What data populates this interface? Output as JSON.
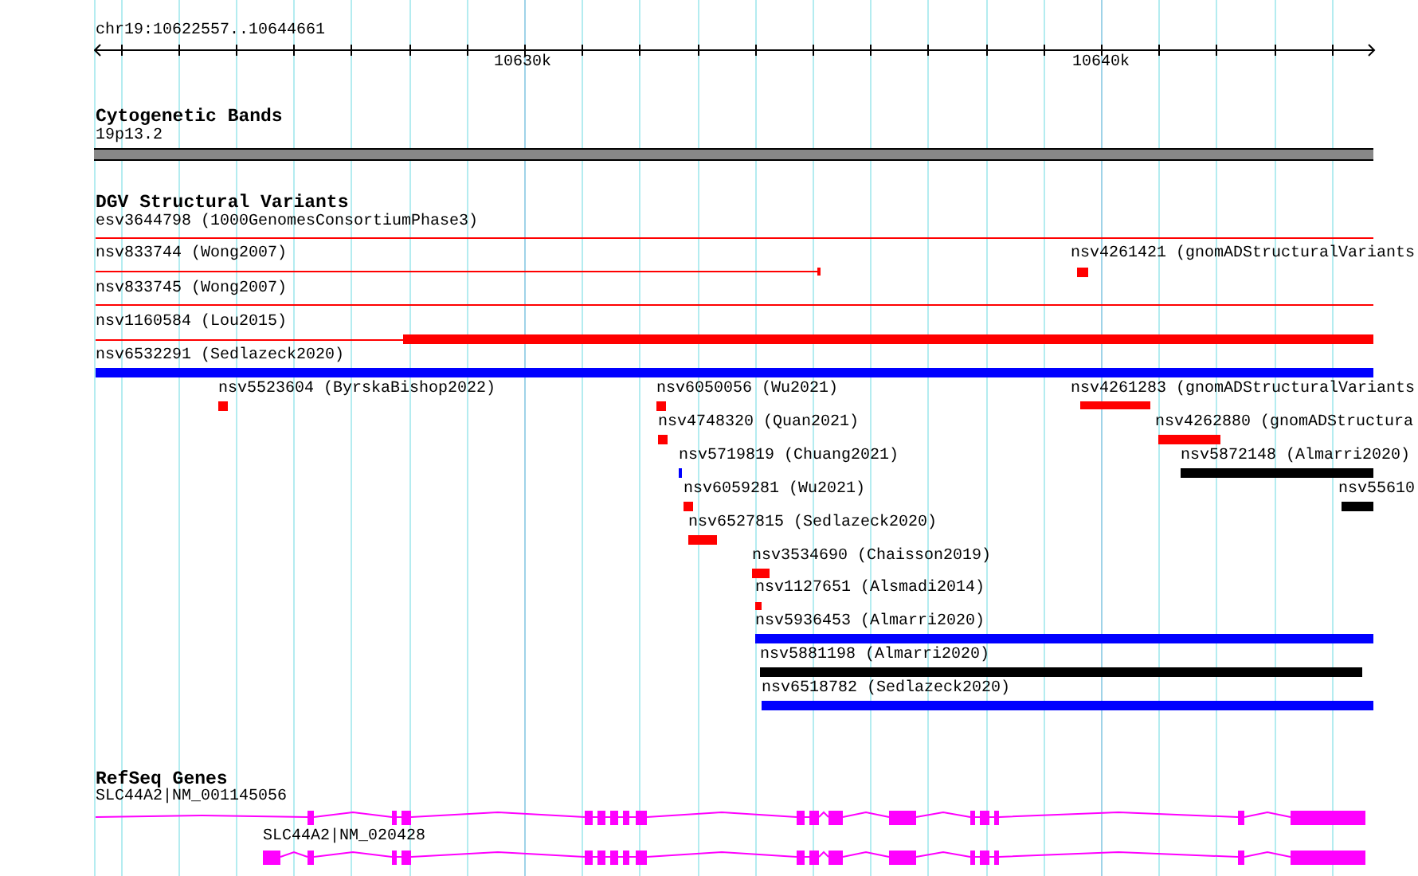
{
  "ruler": {
    "location": "chr19:10622557..10644661",
    "tick_labels": [
      "10630k",
      "10640k"
    ]
  },
  "cytogenetic": {
    "title": "Cytogenetic Bands",
    "band": "19p13.2"
  },
  "dgv": {
    "title": "DGV Structural Variants",
    "variants": [
      {
        "label": "esv3644798 (1000GenomesConsortiumPhase3)",
        "color": "#ff0000"
      },
      {
        "label": "nsv833744 (Wong2007)",
        "color": "#ff0000"
      },
      {
        "label": "nsv4261421 (gnomADStructuralVariants",
        "color": "#ff0000"
      },
      {
        "label": "nsv833745 (Wong2007)",
        "color": "#ff0000"
      },
      {
        "label": "nsv1160584 (Lou2015)",
        "color": "#ff0000"
      },
      {
        "label": "nsv6532291 (Sedlazeck2020)",
        "color": "#0000ff"
      },
      {
        "label": "nsv5523604 (ByrskaBishop2022)",
        "color": "#ff0000"
      },
      {
        "label": "nsv6050056 (Wu2021)",
        "color": "#ff0000"
      },
      {
        "label": "nsv4261283 (gnomADStructuralVariants",
        "color": "#ff0000"
      },
      {
        "label": "nsv4748320 (Quan2021)",
        "color": "#ff0000"
      },
      {
        "label": "nsv4262880 (gnomADStructura",
        "color": "#ff0000"
      },
      {
        "label": "nsv5719819 (Chuang2021)",
        "color": "#0000ff"
      },
      {
        "label": "nsv5872148 (Almarri2020)",
        "color": "#000000"
      },
      {
        "label": "nsv6059281 (Wu2021)",
        "color": "#ff0000"
      },
      {
        "label": "nsv55610",
        "color": "#000000"
      },
      {
        "label": "nsv6527815 (Sedlazeck2020)",
        "color": "#ff0000"
      },
      {
        "label": "nsv3534690 (Chaisson2019)",
        "color": "#ff0000"
      },
      {
        "label": "nsv1127651 (Alsmadi2014)",
        "color": "#ff0000"
      },
      {
        "label": "nsv5936453 (Almarri2020)",
        "color": "#0000ff"
      },
      {
        "label": "nsv5881198 (Almarri2020)",
        "color": "#000000"
      },
      {
        "label": "nsv6518782 (Sedlazeck2020)",
        "color": "#0000ff"
      }
    ]
  },
  "refseq": {
    "title": "RefSeq Genes",
    "transcripts": [
      {
        "label": "SLC44A2|NM_001145056"
      },
      {
        "label": "SLC44A2|NM_020428"
      }
    ]
  }
}
